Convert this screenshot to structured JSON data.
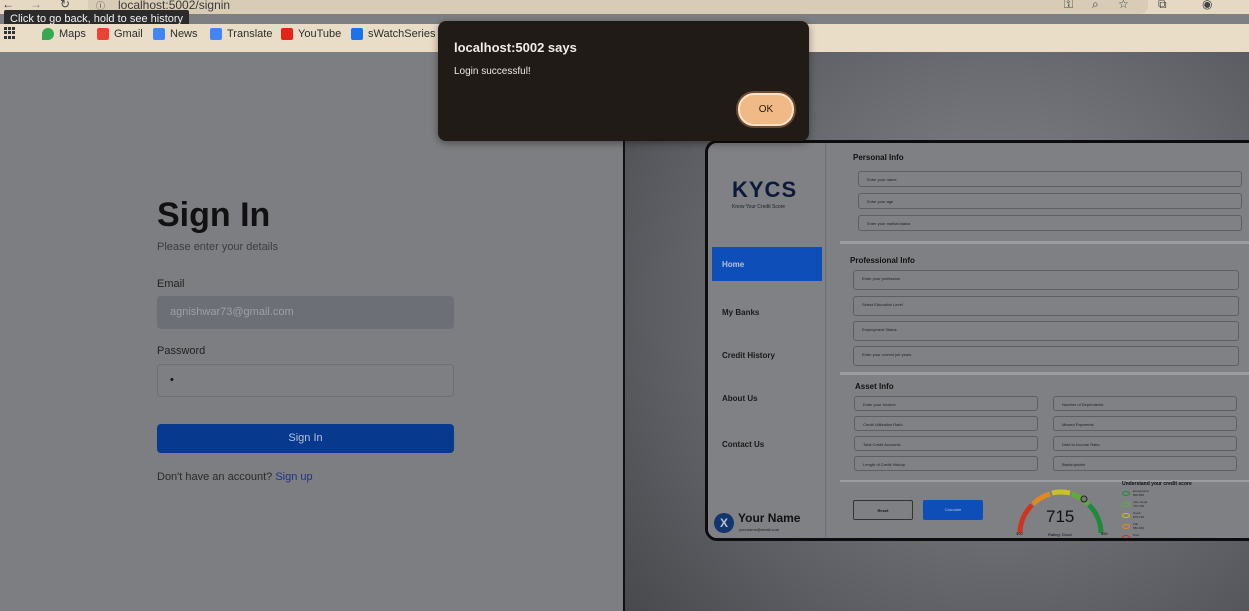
{
  "browser": {
    "url": "localhost:5002/signin",
    "tooltip": "Click to go back, hold to see history",
    "bookmarks": [
      {
        "label": "Maps",
        "color": "#34a853"
      },
      {
        "label": "Gmail",
        "color": "#ea4335"
      },
      {
        "label": "News",
        "color": "#4285f4"
      },
      {
        "label": "Translate",
        "color": "#4285f4"
      },
      {
        "label": "YouTube",
        "color": "#e62117"
      },
      {
        "label": "sWatchSeries - W",
        "color": "#1a73e8"
      }
    ]
  },
  "signin": {
    "title": "Sign In",
    "subtitle": "Please enter your details",
    "email_label": "Email",
    "email_value": "agnishwar73@gmail.com",
    "password_label": "Password",
    "password_value": "•",
    "submit_label": "Sign In",
    "no_account_text": "Don't have an account?",
    "signup_link": "Sign up"
  },
  "preview": {
    "logo": "KYCS",
    "logo_tagline": "Know Your Credit Score",
    "nav": [
      "Home",
      "My Banks",
      "Credit History",
      "About Us",
      "Contact Us"
    ],
    "profile_name": "Your Name",
    "profile_email": "yourname@email.com",
    "personal_title": "Personal Info",
    "personal_fields": [
      "Enter your name",
      "Enter your age",
      "Enter your marital status"
    ],
    "professional_title": "Professional Info",
    "professional_fields": [
      "Enter your profession",
      "Select Education Level",
      "Employment Status",
      "Enter your current job years"
    ],
    "asset_title": "Asset Info",
    "asset_fields": [
      "Enter your Income",
      "Number of Dependents",
      "Credit Utilization Ratio",
      "Missed Payments",
      "Total Credit Accounts",
      "Debt to Income Ratio",
      "Length of Credit History",
      "Bankruptcies"
    ],
    "reset_label": "Reset",
    "calculate_label": "Calculate",
    "score": "715",
    "gauge_min": "300",
    "gauge_max": "850",
    "rating_text": "Rating: Good",
    "legend_title": "Understand your credit score",
    "legend": [
      {
        "label": "Exceptional",
        "range": "800-850",
        "color": "#1f8a3a"
      },
      {
        "label": "Very Good",
        "range": "740-799",
        "color": "#5bb033"
      },
      {
        "label": "Good",
        "range": "670-739",
        "color": "#c9c02a"
      },
      {
        "label": "Fair",
        "range": "580-669",
        "color": "#e08a1d"
      },
      {
        "label": "Poor",
        "range": "300-579",
        "color": "#d0331f"
      }
    ]
  },
  "dialog": {
    "title": "localhost:5002 says",
    "message": "Login successful!",
    "ok_label": "OK"
  }
}
